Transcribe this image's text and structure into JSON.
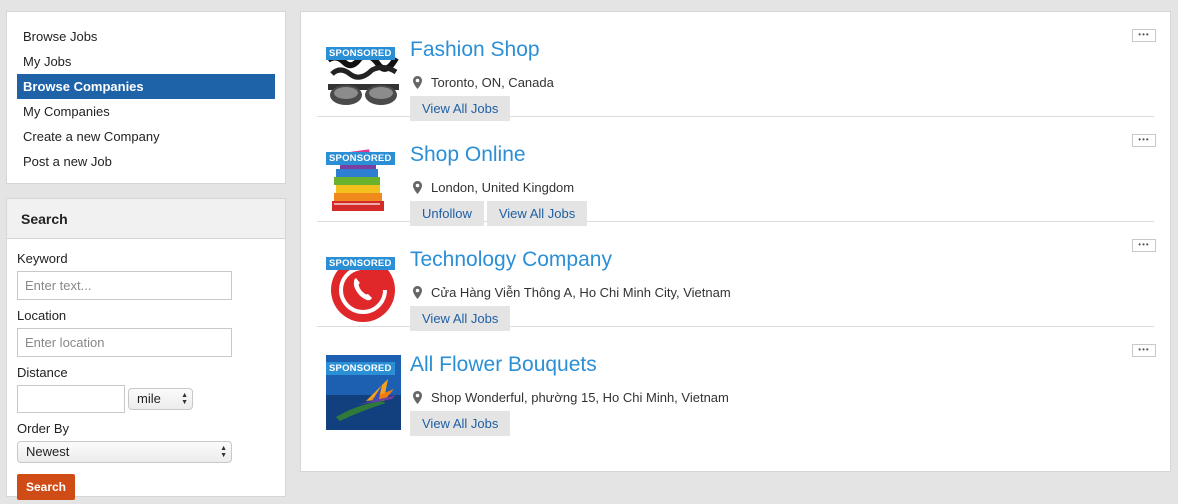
{
  "sidebar": {
    "menu": [
      {
        "label": "Browse Jobs",
        "active": false
      },
      {
        "label": "My Jobs",
        "active": false
      },
      {
        "label": "Browse Companies",
        "active": true
      },
      {
        "label": "My Companies",
        "active": false
      },
      {
        "label": "Create a new Company",
        "active": false
      },
      {
        "label": "Post a new Job",
        "active": false
      }
    ]
  },
  "search": {
    "title": "Search",
    "keyword_label": "Keyword",
    "keyword_placeholder": "Enter text...",
    "location_label": "Location",
    "location_placeholder": "Enter location",
    "distance_label": "Distance",
    "distance_value": "",
    "distance_unit": "mile",
    "order_label": "Order By",
    "order_value": "Newest",
    "button_label": "Search"
  },
  "companies": [
    {
      "badge": "SPONSORED",
      "name": "Fashion Shop",
      "location": "Toronto, ON, Canada",
      "buttons": [
        "View All Jobs"
      ],
      "thumb_icon": "sunglasses-image"
    },
    {
      "badge": "SPONSORED",
      "name": "Shop Online",
      "location": "London, United Kingdom",
      "buttons": [
        "Unfollow",
        "View All Jobs"
      ],
      "thumb_icon": "books-stack-image"
    },
    {
      "badge": "SPONSORED",
      "name": "Technology Company",
      "location": "Cửa Hàng Viễn Thông A, Ho Chi Minh City, Vietnam",
      "buttons": [
        "View All Jobs"
      ],
      "thumb_icon": "phone-call-logo"
    },
    {
      "badge": "SPONSORED",
      "name": "All Flower Bouquets",
      "location": "Shop Wonderful, phường 15, Ho Chi Minh, Vietnam",
      "buttons": [
        "View All Jobs"
      ],
      "thumb_icon": "bird-of-paradise-flower-image"
    }
  ],
  "more_button_label": "•••",
  "colors": {
    "accent": "#2b8fd6",
    "active_menu": "#1e63a8",
    "search_button": "#cf4c17"
  }
}
